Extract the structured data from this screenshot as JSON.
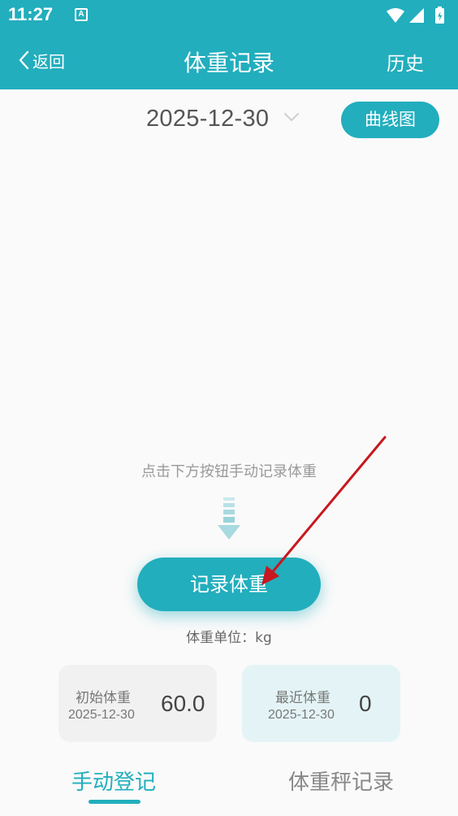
{
  "status_bar": {
    "time": "11:27",
    "notification_icon": "A",
    "icons": [
      "wifi-icon",
      "signal-icon",
      "battery-icon"
    ]
  },
  "app_bar": {
    "back_label": "返回",
    "title": "体重记录",
    "history_label": "历史"
  },
  "date_selector": {
    "date": "2025-12-30",
    "curve_button_label": "曲线图"
  },
  "record": {
    "hint": "点击下方按钮手动记录体重",
    "button_label": "记录体重",
    "unit_text": "体重单位：kg"
  },
  "cards": {
    "initial": {
      "label": "初始体重",
      "date": "2025-12-30",
      "value": "60.0"
    },
    "latest": {
      "label": "最近体重",
      "date": "2025-12-30",
      "value": "0"
    }
  },
  "tabs": [
    {
      "label": "手动登记",
      "active": true
    },
    {
      "label": "体重秤记录",
      "active": false
    }
  ],
  "colors": {
    "primary": "#22aebd",
    "annotation_arrow": "#c8171e"
  }
}
